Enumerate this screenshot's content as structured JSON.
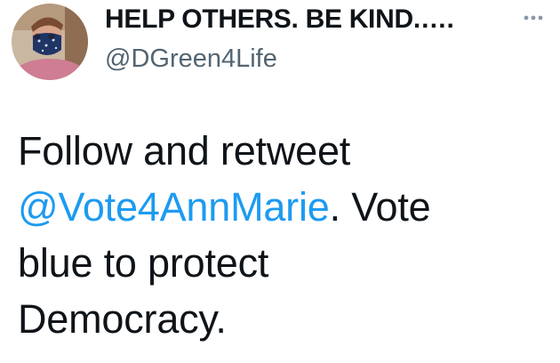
{
  "tweet": {
    "author": {
      "display_name": "HELP OTHERS. BE KIND.….",
      "handle": "@DGreen4Life",
      "avatar_icon": "profile-photo-masked-person"
    },
    "more_icon": "more-horizontal-icon",
    "text": {
      "line1": "Follow and retweet",
      "mention": "@Vote4AnnMarie",
      "after_mention": ". Vote",
      "line3": "blue to protect",
      "line4": "Democracy."
    }
  },
  "colors": {
    "text": "#0f1419",
    "secondary": "#536471",
    "link": "#1d9bf0"
  }
}
